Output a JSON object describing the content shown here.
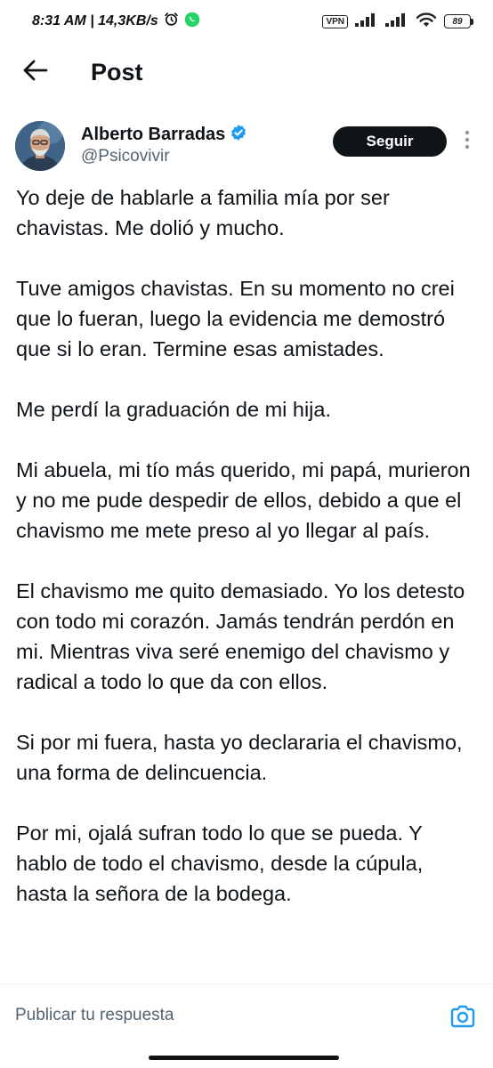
{
  "status_bar": {
    "time_and_speed": "8:31 AM | 14,3KB/s",
    "vpn_label": "VPN",
    "battery_level": "89"
  },
  "header": {
    "title": "Post"
  },
  "author": {
    "name": "Alberto Barradas",
    "handle": "@Psicovivir",
    "verified": true,
    "follow_label": "Seguir"
  },
  "post": {
    "paragraphs": [
      "Yo deje de hablarle a familia mía por ser chavistas. Me dolió y mucho.",
      "Tuve amigos chavistas. En su momento no crei que lo fueran, luego la evidencia me demostró que si lo eran. Termine esas amistades.",
      "Me perdí la graduación de mi hija.",
      "Mi abuela, mi tío más querido, mi papá, murieron y no me pude despedir de ellos, debido a que el chavismo me mete preso al yo llegar al país.",
      "El chavismo me quito demasiado. Yo los detesto con todo mi corazón. Jamás tendrán perdón en mi. Mientras viva seré enemigo del chavismo y radical a todo lo que da con ellos.",
      "Si por mi fuera, hasta yo declararia el chavismo, una forma de delincuencia.",
      "Por mi, ojalá sufran todo lo que se pueda. Y hablo de todo el chavismo, desde la cúpula, hasta la señora de la bodega."
    ]
  },
  "reply": {
    "placeholder": "Publicar tu respuesta"
  },
  "icons": {
    "back": "arrow-left-icon",
    "verified": "verified-badge-icon",
    "more": "more-vertical-icon",
    "camera": "camera-icon",
    "alarm": "alarm-icon",
    "whatsapp": "whatsapp-icon",
    "signal": "signal-icon",
    "wifi": "wifi-icon",
    "battery": "battery-icon"
  },
  "colors": {
    "accent": "#1d9bf0",
    "text_primary": "#0f1419",
    "text_secondary": "#536471",
    "follow_button_bg": "#0f1419",
    "whatsapp_green": "#25d366"
  }
}
